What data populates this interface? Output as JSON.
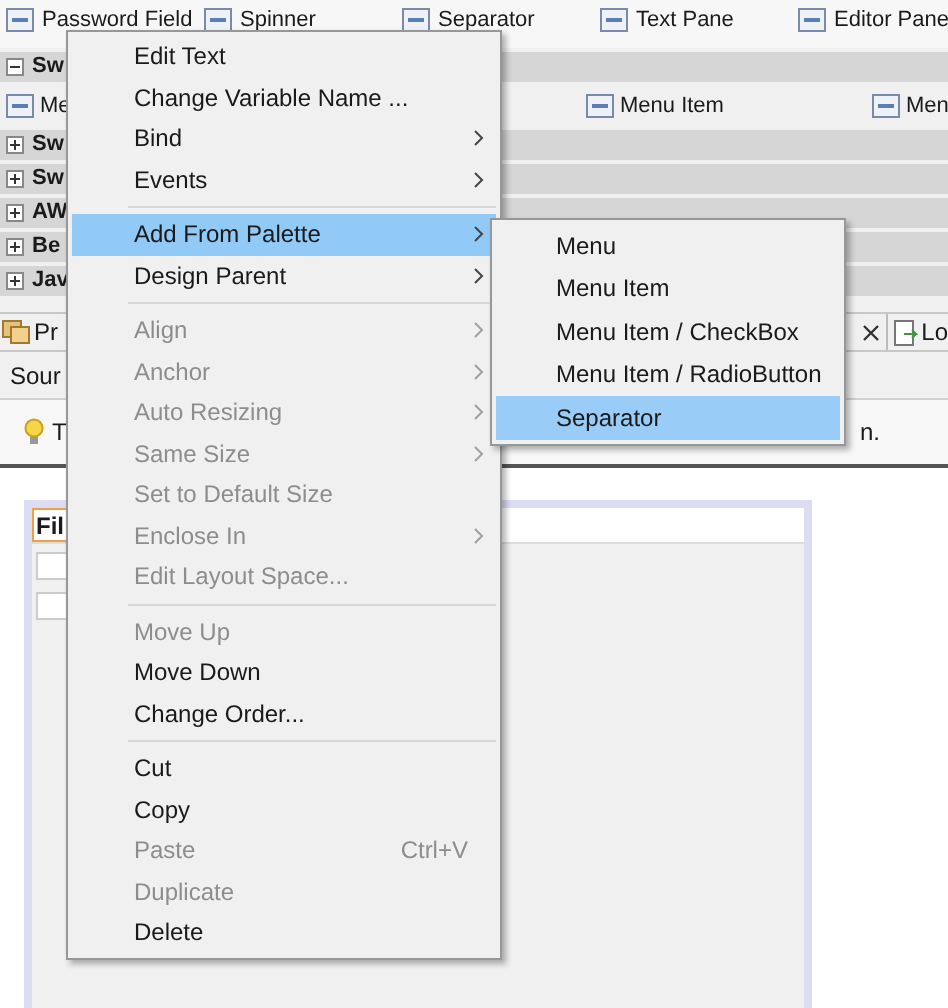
{
  "palette_row": [
    {
      "label": "Password Field"
    },
    {
      "label": "Spinner"
    },
    {
      "label": "Separator"
    },
    {
      "label": "Text Pane"
    },
    {
      "label": "Editor Pane"
    }
  ],
  "palette_groups": [
    {
      "label": "Sw",
      "expanded": true,
      "items": [
        {
          "label": "Me"
        },
        {
          "label": "Menu Item"
        },
        {
          "label": "Men"
        }
      ]
    },
    {
      "label": "Sw",
      "expanded": false
    },
    {
      "label": "Sw",
      "expanded": false
    },
    {
      "label": "AW",
      "expanded": false
    },
    {
      "label": "Be",
      "expanded": false
    },
    {
      "label": "Jav",
      "expanded": false
    }
  ],
  "editor_tabs": [
    {
      "label": "Pr"
    },
    {
      "label": "Lo"
    }
  ],
  "toolbar": {
    "label": "Sour"
  },
  "hint": {
    "text_start": "T",
    "text_end": "n."
  },
  "canvas": {
    "menu_bar": "Fil"
  },
  "context_menu": {
    "items": [
      {
        "kind": "item",
        "label": "Edit Text",
        "disabled": false,
        "selected": false,
        "submenu": false
      },
      {
        "kind": "item",
        "label": "Change Variable Name ...",
        "disabled": false,
        "selected": false,
        "submenu": false
      },
      {
        "kind": "item",
        "label": "Bind",
        "disabled": false,
        "selected": false,
        "submenu": true
      },
      {
        "kind": "item",
        "label": "Events",
        "disabled": false,
        "selected": false,
        "submenu": true
      },
      {
        "kind": "separator"
      },
      {
        "kind": "item",
        "label": "Add From Palette",
        "disabled": false,
        "selected": true,
        "submenu": true
      },
      {
        "kind": "item",
        "label": "Design Parent",
        "disabled": false,
        "selected": false,
        "submenu": true
      },
      {
        "kind": "separator"
      },
      {
        "kind": "item",
        "label": "Align",
        "disabled": true,
        "selected": false,
        "submenu": true
      },
      {
        "kind": "item",
        "label": "Anchor",
        "disabled": true,
        "selected": false,
        "submenu": true
      },
      {
        "kind": "item",
        "label": "Auto Resizing",
        "disabled": true,
        "selected": false,
        "submenu": true
      },
      {
        "kind": "item",
        "label": "Same Size",
        "disabled": true,
        "selected": false,
        "submenu": true
      },
      {
        "kind": "item",
        "label": "Set to Default Size",
        "disabled": true,
        "selected": false,
        "submenu": false
      },
      {
        "kind": "item",
        "label": "Enclose In",
        "disabled": true,
        "selected": false,
        "submenu": true
      },
      {
        "kind": "item",
        "label": "Edit Layout Space...",
        "disabled": true,
        "selected": false,
        "submenu": false
      },
      {
        "kind": "separator"
      },
      {
        "kind": "item",
        "label": "Move Up",
        "disabled": true,
        "selected": false,
        "submenu": false
      },
      {
        "kind": "item",
        "label": "Move Down",
        "disabled": false,
        "selected": false,
        "submenu": false
      },
      {
        "kind": "item",
        "label": "Change Order...",
        "disabled": false,
        "selected": false,
        "submenu": false
      },
      {
        "kind": "separator"
      },
      {
        "kind": "item",
        "label": "Cut",
        "disabled": false,
        "selected": false,
        "submenu": false
      },
      {
        "kind": "item",
        "label": "Copy",
        "disabled": false,
        "selected": false,
        "submenu": false
      },
      {
        "kind": "item",
        "label": "Paste",
        "shortcut": "Ctrl+V",
        "disabled": true,
        "selected": false,
        "submenu": false
      },
      {
        "kind": "item",
        "label": "Duplicate",
        "disabled": true,
        "selected": false,
        "submenu": false
      },
      {
        "kind": "item",
        "label": "Delete",
        "disabled": false,
        "selected": false,
        "submenu": false
      }
    ]
  },
  "submenu": {
    "items": [
      {
        "label": "Menu",
        "selected": false
      },
      {
        "label": "Menu Item",
        "selected": false
      },
      {
        "label": "Menu Item / CheckBox",
        "selected": false
      },
      {
        "label": "Menu Item / RadioButton",
        "selected": false
      },
      {
        "label": "Separator",
        "selected": true
      }
    ]
  }
}
